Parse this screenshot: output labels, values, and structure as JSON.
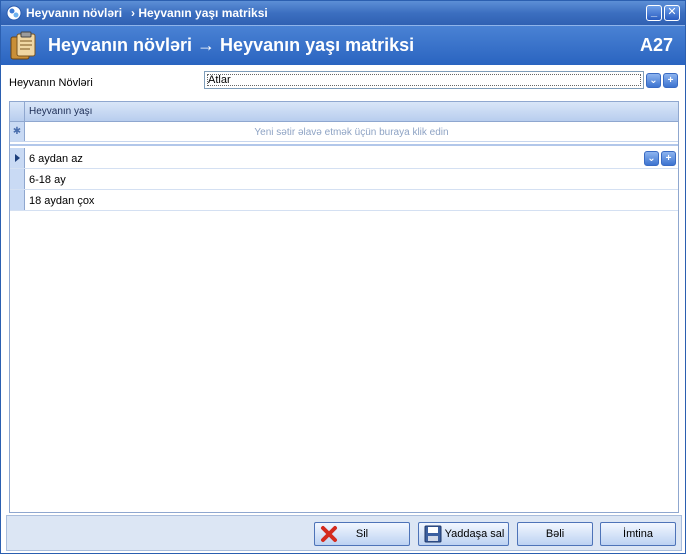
{
  "window": {
    "title_main": "Heyvanın növləri",
    "title_crumb": "› Heyvanın yaşı matriksi",
    "minimize_glyph": "_",
    "close_glyph": "✕"
  },
  "header": {
    "title": "Heyvanın növləri → Heyvanın yaşı matriksi",
    "code": "A27"
  },
  "filter": {
    "label": "Heyvanın Növləri",
    "value": "Atlar",
    "dropdown_glyph": "⌄",
    "add_glyph": "+"
  },
  "grid": {
    "column_header": "Heyvanın yaşı",
    "new_row_glyph": "✱",
    "new_row_hint": "Yeni sətir əlavə etmək üçün buraya klik edin",
    "rows": [
      {
        "value": "6 aydan az"
      },
      {
        "value": "6-18 ay"
      },
      {
        "value": "18 aydan çox"
      }
    ]
  },
  "footer": {
    "delete_label": "Sil",
    "save_label": "Yaddaşa sal",
    "ok_label": "Bəli",
    "cancel_label": "İmtina"
  },
  "colors": {
    "title_bar": "#3c6fc0",
    "header_band": "#2a64c0",
    "grid_header": "#b8cdee",
    "row_indicator": "#c9daf4",
    "delete_icon": "#d42b1e"
  }
}
